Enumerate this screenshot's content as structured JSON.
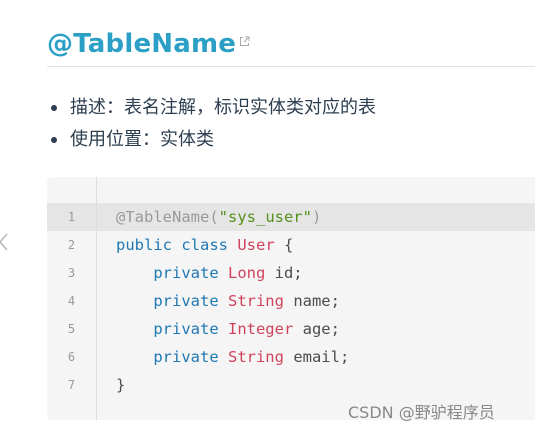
{
  "heading": {
    "title": "@TableName"
  },
  "bullets": [
    "描述：表名注解，标识实体类对应的表",
    "使用位置：实体类"
  ],
  "code": {
    "lines": [
      {
        "num": "1",
        "tokens": [
          {
            "t": "@TableName(",
            "c": "an"
          },
          {
            "t": "\"sys_user\"",
            "c": "st"
          },
          {
            "t": ")",
            "c": "an"
          }
        ]
      },
      {
        "num": "2",
        "tokens": [
          {
            "t": "public class ",
            "c": "kw"
          },
          {
            "t": "User",
            "c": "ty"
          },
          {
            "t": " {",
            "c": "pl"
          }
        ]
      },
      {
        "num": "3",
        "tokens": [
          {
            "t": "    private ",
            "c": "kw"
          },
          {
            "t": "Long",
            "c": "ty"
          },
          {
            "t": " id;",
            "c": "pl"
          }
        ]
      },
      {
        "num": "4",
        "tokens": [
          {
            "t": "    private ",
            "c": "kw"
          },
          {
            "t": "String",
            "c": "ty"
          },
          {
            "t": " name;",
            "c": "pl"
          }
        ]
      },
      {
        "num": "5",
        "tokens": [
          {
            "t": "    private ",
            "c": "kw"
          },
          {
            "t": "Integer",
            "c": "ty"
          },
          {
            "t": " age;",
            "c": "pl"
          }
        ]
      },
      {
        "num": "6",
        "tokens": [
          {
            "t": "    private ",
            "c": "kw"
          },
          {
            "t": "String",
            "c": "ty"
          },
          {
            "t": " email;",
            "c": "pl"
          }
        ]
      },
      {
        "num": "7",
        "tokens": [
          {
            "t": "}",
            "c": "pl"
          }
        ]
      }
    ],
    "highlighted_line": "1"
  },
  "watermark": "CSDN @野驴程序员",
  "colors": {
    "title": "#2b9fc6",
    "keyword": "#1f78b4",
    "type": "#d0445b",
    "string": "#55911a",
    "annotation": "#9a9a9a"
  },
  "icons": {
    "title_link": "external-link-icon",
    "back": "chevron-left-icon"
  }
}
